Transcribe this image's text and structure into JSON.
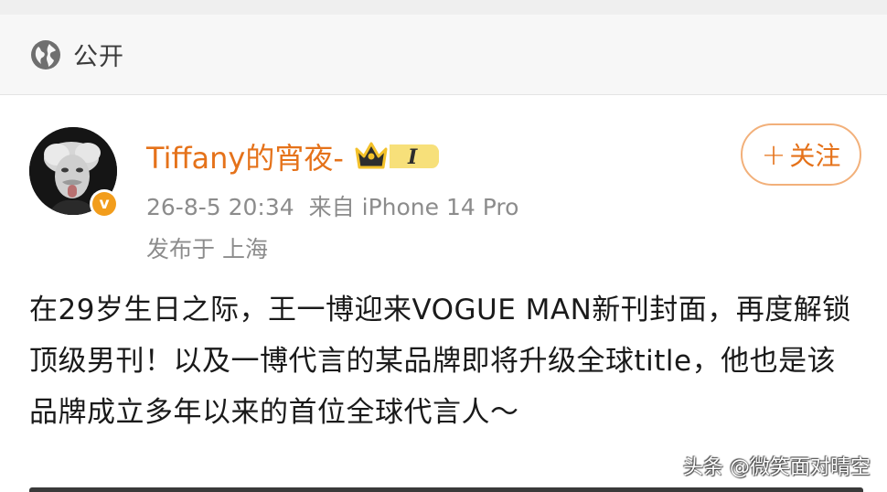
{
  "visibility": {
    "icon": "globe-icon",
    "label": "公开"
  },
  "post": {
    "author": {
      "name": "Tiffany的宵夜-",
      "avatar": "avatar-photo",
      "verified_icon": "v-verified-icon",
      "verified_letter": "v",
      "member_badge": {
        "icon": "crown-member-badge-icon",
        "level": "I"
      }
    },
    "follow_label": "关注",
    "follow_icon": "plus-icon",
    "follow_plus": "+",
    "timestamp": "26-8-5 20:34",
    "source": "来自 iPhone 14 Pro",
    "location": "发布于 上海",
    "content": "在29岁生日之际，王一博迎来VOGUE MAN新刊封面，再度解锁顶级男刊！以及一博代言的某品牌即将升级全球title，他也是该品牌成立多年以来的首位全球代言人～"
  },
  "watermark": "头条 @微笑面对晴空",
  "colors": {
    "accent": "#e5721a",
    "follow_border": "#f2b07a",
    "meta_text": "#8c8c8c",
    "verified_orange": "#f29d1c",
    "badge_gold": "#f3c12b"
  }
}
